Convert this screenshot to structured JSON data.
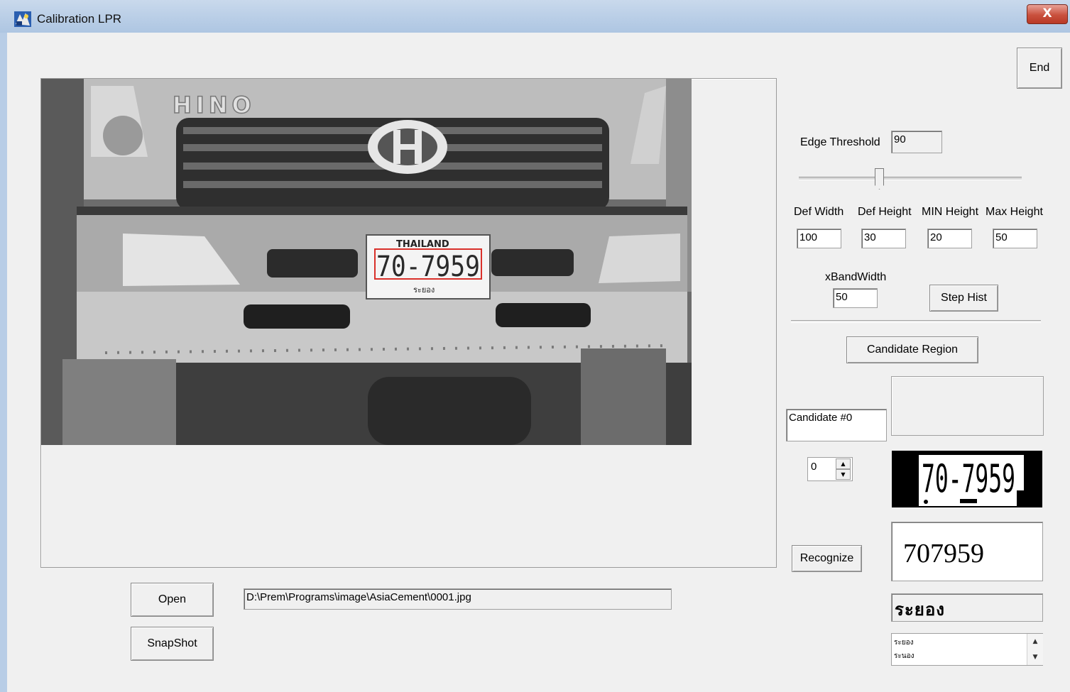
{
  "window": {
    "title": "Calibration LPR",
    "close_label": "X"
  },
  "toolbar": {
    "end_label": "End"
  },
  "edge": {
    "label": "Edge Threshold",
    "value": "90",
    "slider_value": 90
  },
  "params": {
    "def_width_label": "Def Width",
    "def_width": "100",
    "def_height_label": "Def Height",
    "def_height": "30",
    "min_height_label": "MIN Height",
    "min_height": "20",
    "max_height_label": "Max Height",
    "max_height": "50",
    "xband_label": "xBandWidth",
    "xband": "50"
  },
  "buttons": {
    "step_hist": "Step Hist",
    "candidate_region": "Candidate Region",
    "recognize": "Recognize",
    "open": "Open",
    "snapshot": "SnapShot"
  },
  "candidate": {
    "label": "Candidate #0",
    "index": "0"
  },
  "image": {
    "path": "D:\\Prem\\Programs\\image\\AsiaCement\\0001.jpg",
    "plate_country": "THAILAND",
    "plate_number": "70-7959",
    "plate_province": "ระยอง",
    "truck_brand": "HINO",
    "plate_bin_number": "70-7959"
  },
  "result": {
    "number": "707959",
    "province": "ระยอง",
    "province_candidates": [
      "ระยอง",
      "ระนอง"
    ]
  },
  "icons": {
    "app": "app-icon",
    "close": "close-icon",
    "spin_up": "spin-up-icon",
    "spin_down": "spin-down-icon"
  },
  "colors": {
    "plate_box": "#d9302a",
    "title_gradient": "#b8cde6",
    "close_red": "#c9503d"
  }
}
